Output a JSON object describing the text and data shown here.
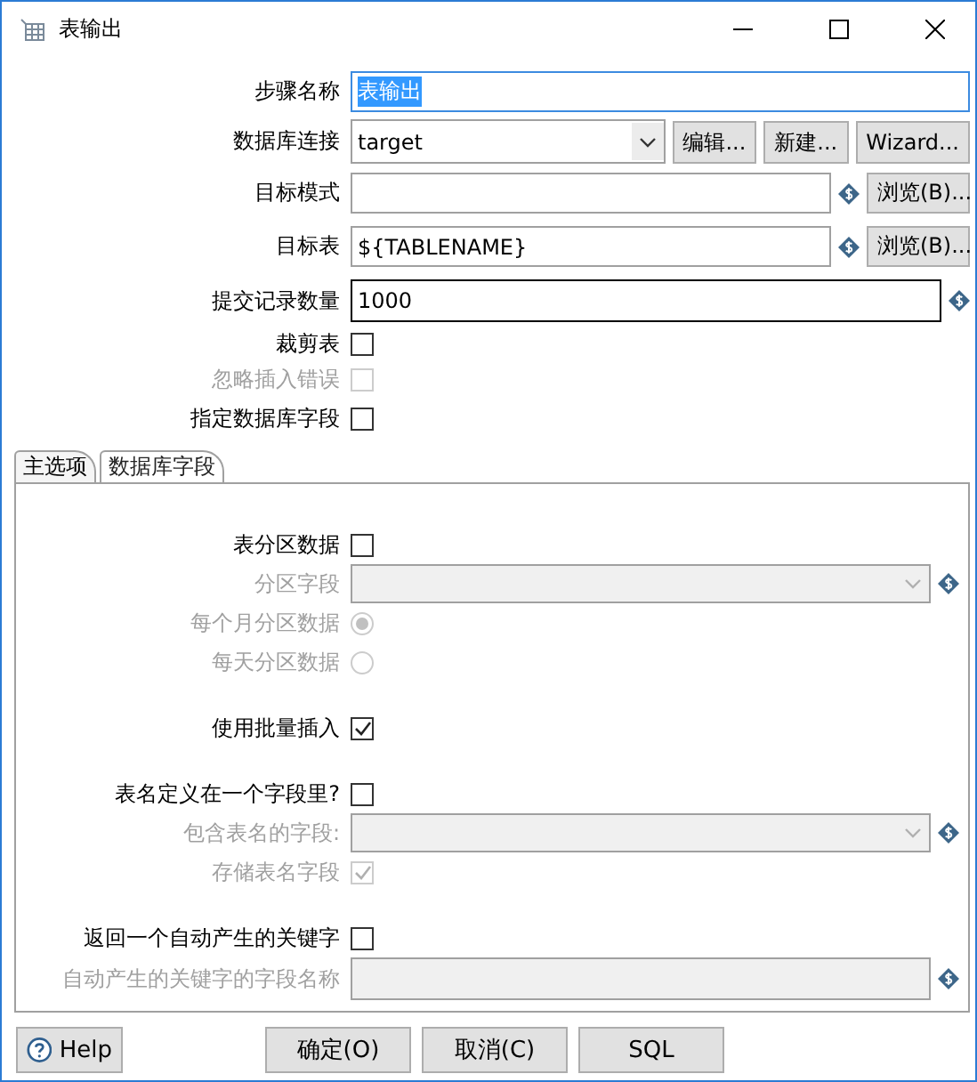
{
  "window": {
    "title": "表输出"
  },
  "fields": [
    {
      "kind": "text",
      "label": "步骤名称",
      "value": "表输出",
      "highlighted": true,
      "focused": false
    },
    {
      "kind": "combo",
      "label": "数据库连接",
      "value": "target",
      "buttons": [
        "编辑...",
        "新建...",
        "Wizard..."
      ]
    },
    {
      "kind": "text",
      "label": "目标模式",
      "highlighted": false,
      "focused": false,
      "variable": true,
      "button": "浏览(B)..."
    },
    {
      "kind": "text",
      "label": "目标表",
      "value": "${TABLENAME}",
      "highlighted": false,
      "focused": false,
      "variable": true,
      "button": "浏览(B)..."
    },
    {
      "kind": "text",
      "label": "提交记录数量",
      "value": "1000",
      "highlighted": false,
      "focused": true,
      "variable": true
    },
    {
      "kind": "checkbox",
      "label": "裁剪表",
      "checked": false,
      "disabled": false
    },
    {
      "kind": "checkbox",
      "label": "忽略插入错误",
      "checked": false,
      "disabled": true
    },
    {
      "kind": "checkbox",
      "label": "指定数据库字段",
      "checked": false,
      "disabled": false
    }
  ],
  "tabs": [
    {
      "label": "主选项",
      "selected": true
    },
    {
      "label": "数据库字段",
      "selected": false
    }
  ],
  "groups": [
    {
      "items": [
        {
          "kind": "checkbox",
          "label": "表分区数据",
          "checked": false,
          "disabled": false
        },
        {
          "kind": "combo",
          "label": "分区字段",
          "disabled": true,
          "variable": true
        },
        {
          "kind": "radio",
          "label": "每个月分区数据",
          "selected": true,
          "disabled": true
        },
        {
          "kind": "radio",
          "label": "每天分区数据",
          "selected": false,
          "disabled": true
        }
      ]
    },
    {
      "items": [
        {
          "kind": "checkbox",
          "label": "使用批量插入",
          "checked": true,
          "disabled": false
        }
      ]
    },
    {
      "items": [
        {
          "kind": "checkbox",
          "label": "表名定义在一个字段里?",
          "checked": false,
          "disabled": false
        },
        {
          "kind": "combo",
          "label": "包含表名的字段:",
          "disabled": true,
          "variable": true
        },
        {
          "kind": "checkbox",
          "label": "存储表名字段",
          "checked": true,
          "disabled": true
        }
      ]
    },
    {
      "items": [
        {
          "kind": "checkbox",
          "label": "返回一个自动产生的关键字",
          "checked": false,
          "disabled": false
        },
        {
          "kind": "text",
          "label": "自动产生的关键字的字段名称",
          "disabled": true,
          "variable": true
        }
      ]
    }
  ],
  "footer": {
    "help": "Help",
    "buttons": [
      "确定(O)",
      "取消(C)",
      "SQL"
    ]
  }
}
